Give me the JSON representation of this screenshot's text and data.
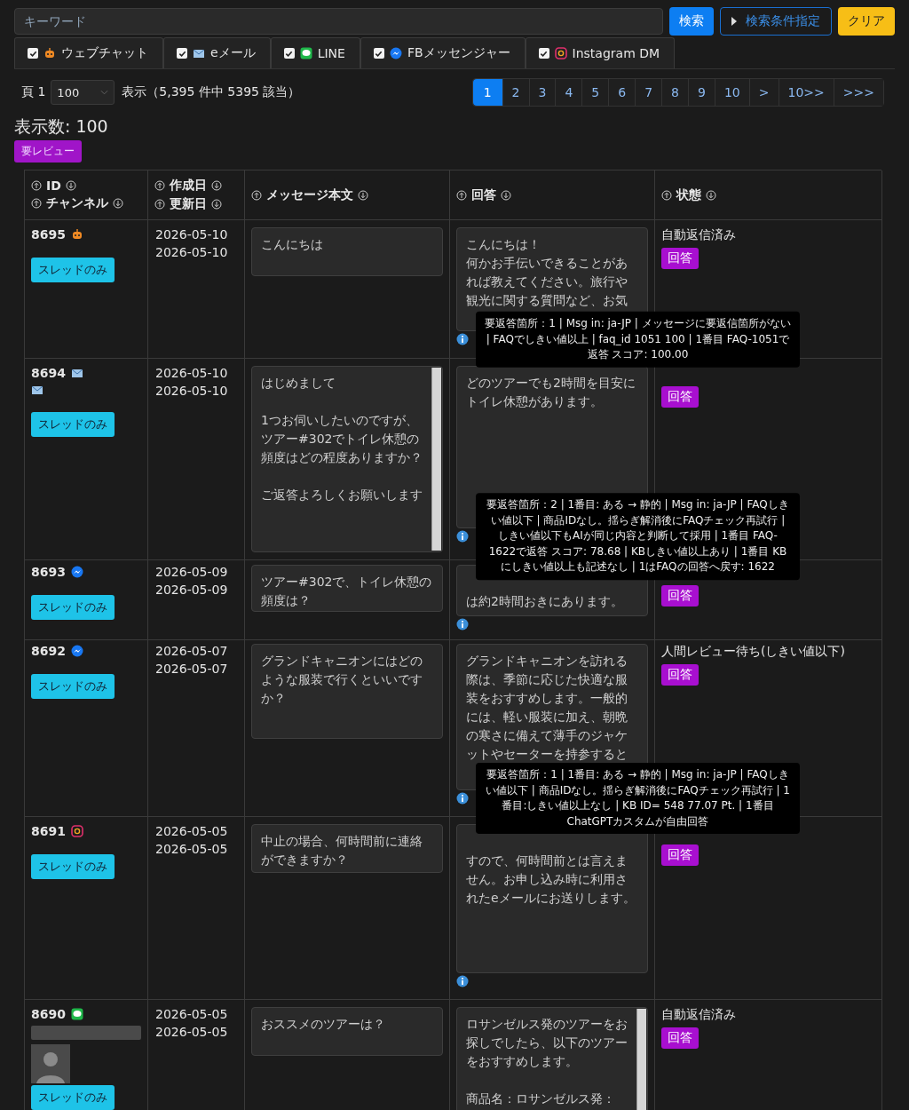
{
  "search": {
    "placeholder": "キーワード"
  },
  "buttons": [
    {
      "label": "検索",
      "kind": "primary"
    },
    {
      "label": "検索条件指定",
      "kind": "outline"
    },
    {
      "label": "クリア",
      "kind": "warning"
    }
  ],
  "channel_filters": [
    {
      "label": "ウェブチャット",
      "kind": "webchat",
      "checked": true
    },
    {
      "label": "eメール",
      "kind": "email",
      "checked": true
    },
    {
      "label": "LINE",
      "kind": "line",
      "checked": true
    },
    {
      "label": "FBメッセンジャー",
      "kind": "messenger",
      "checked": true
    },
    {
      "label": "Instagram DM",
      "kind": "instagram",
      "checked": true
    }
  ],
  "pager": {
    "page_label": "頁 1",
    "per_page": "100",
    "summary": "表示（5,395 件中 5395 該当）",
    "pages": [
      {
        "label": "1",
        "selected": true
      },
      {
        "label": "2",
        "selected": false
      },
      {
        "label": "3",
        "selected": false
      },
      {
        "label": "4",
        "selected": false
      },
      {
        "label": "5",
        "selected": false
      },
      {
        "label": "6",
        "selected": false
      },
      {
        "label": "7",
        "selected": false
      },
      {
        "label": "8",
        "selected": false
      },
      {
        "label": "9",
        "selected": false
      },
      {
        "label": "10",
        "selected": false
      },
      {
        "label": ">",
        "selected": false
      },
      {
        "label": "10>>",
        "selected": false
      },
      {
        "label": ">>>",
        "selected": false
      }
    ]
  },
  "display_count": "表示数: 100",
  "review_badge": "要レビュー",
  "table": {
    "columns": [
      {
        "lines": [
          "ID",
          "チャンネル"
        ]
      },
      {
        "lines": [
          "作成日",
          "更新日"
        ]
      },
      {
        "lines": [
          "メッセージ本文"
        ]
      },
      {
        "lines": [
          "回答"
        ]
      },
      {
        "lines": [
          "状態"
        ]
      }
    ],
    "rows": [
      {
        "id": "8695",
        "channels": [
          {
            "kind": "webchat"
          }
        ],
        "has_profile": false,
        "thread_button": "スレッドのみ",
        "created": "2026-05-10",
        "updated": "2026-05-10",
        "message": [
          "こんにちは"
        ],
        "message_scrollbar": false,
        "answer": [
          "こんにちは！",
          "何かお手伝いできることがあれば教えてください。旅行や観光に関する質問など、お気"
        ],
        "answer_scrollbar": false,
        "info_icon": true,
        "tooltip": "要返答箇所：1 | Msg in: ja-JP | メッセージに要返信箇所がない | FAQでしきい値以上 | faq_id 1051 100 | 1番目 FAQ-1051で返答 スコア: 100.00",
        "status": "自動返信済み",
        "reply_button": "回答"
      },
      {
        "id": "8694",
        "channels": [
          {
            "kind": "email"
          },
          {
            "kind": "email"
          }
        ],
        "has_profile": false,
        "thread_button": "スレッドのみ",
        "created": "2026-05-10",
        "updated": "2026-05-10",
        "message": [
          "はじめまして",
          "1つお伺いしたいのですが、ツアー#302でトイレ休憩の頻度はどの程度ありますか？",
          "ご返答よろしくお願いします"
        ],
        "message_scrollbar": true,
        "answer": [
          "どのツアーでも2時間を目安にトイレ休憩があります。"
        ],
        "answer_scrollbar": false,
        "info_icon": true,
        "tooltip": "要返答箇所：2 | 1番目: ある → 静的 | Msg in: ja-JP | FAQしきい値以下 | 商品IDなし。揺らぎ解消後にFAQチェック再試行 | しきい値以下もAIが同じ内容と判断して採用 | 1番目 FAQ-1622で返答 スコア: 78.68 | KBしきい値以上あり | 1番目 KBにしきい値以上も記述なし | 1はFAQの回答へ戻す: 1622",
        "reply_button": "回答"
      },
      {
        "id": "8693",
        "channels": [
          {
            "kind": "messenger"
          }
        ],
        "has_profile": false,
        "thread_button": "スレッドのみ",
        "created": "2026-05-09",
        "updated": "2026-05-09",
        "message": [
          "ツアー#302で、トイレ休憩の頻度は？"
        ],
        "message_scrollbar": false,
        "answer": [
          "は約2時間おきにあります。"
        ],
        "answer_scrollbar": false,
        "info_icon": true,
        "reply_button": "回答"
      },
      {
        "id": "8692",
        "channels": [
          {
            "kind": "messenger"
          }
        ],
        "has_profile": false,
        "thread_button": "スレッドのみ",
        "created": "2026-05-07",
        "updated": "2026-05-07",
        "message": [
          "グランドキャニオンにはどのような服装で行くといいですか？"
        ],
        "message_scrollbar": false,
        "answer": [
          "グランドキャニオンを訪れる際は、季節に応じた快適な服装をおすすめします。一般的には、軽い服装に加え、朝晩の寒さに備えて薄手のジャケットやセーターを持参すると"
        ],
        "answer_scrollbar": false,
        "info_icon": true,
        "tooltip": "要返答箇所：1 | 1番目: ある → 静的 | Msg in: ja-JP | FAQしきい値以下 | 商品IDなし。揺らぎ解消後にFAQチェック再試行 | 1番目:しきい値以上なし | KB ID= 548 77.07 Pt. | 1番目 ChatGPTカスタムが自由回答",
        "status": "人間レビュー待ち(しきい値以下)",
        "reply_button": "回答"
      },
      {
        "id": "8691",
        "channels": [
          {
            "kind": "instagram"
          }
        ],
        "has_profile": false,
        "thread_button": "スレッドのみ",
        "created": "2026-05-05",
        "updated": "2026-05-05",
        "message": [
          "中止の場合、何時間前に連絡ができますか？"
        ],
        "message_scrollbar": false,
        "answer": [
          "すので、何時間前とは言えません。お申し込み時に利用されたeメールにお送りします。"
        ],
        "answer_scrollbar": false,
        "info_icon": true,
        "reply_button": "回答"
      },
      {
        "id": "8690",
        "channels": [
          {
            "kind": "line"
          }
        ],
        "has_profile": true,
        "thread_button": "スレッドのみ",
        "created": "2026-05-05",
        "updated": "2026-05-05",
        "message": [
          "おススメのツアーは？"
        ],
        "message_scrollbar": false,
        "answer": [
          "ロサンゼルス発のツアーをお探しでしたら、以下のツアーをおすすめします。",
          "商品名：ロサンゼルス発："
        ],
        "answer_scrollbar": true,
        "info_icon": false,
        "status": "自動返信済み",
        "reply_button": "回答"
      }
    ]
  }
}
